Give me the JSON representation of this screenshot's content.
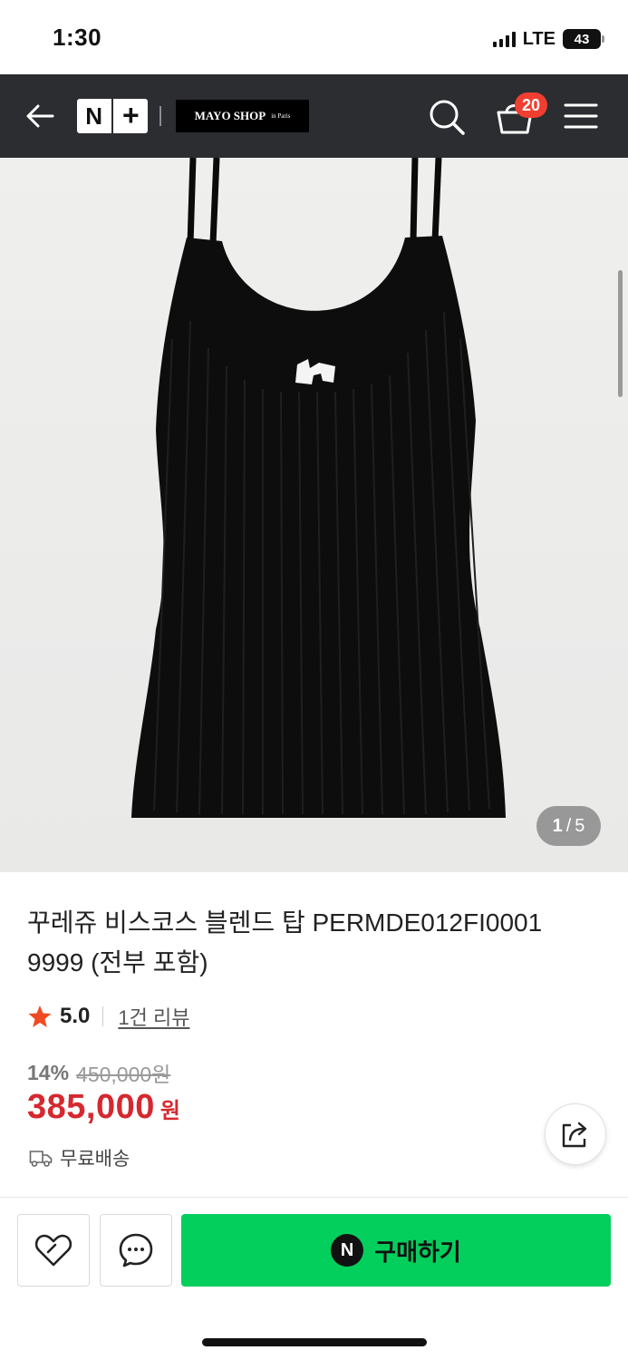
{
  "status_bar": {
    "time": "1:30",
    "network": "LTE",
    "battery": "43"
  },
  "header": {
    "logo_n": "N",
    "logo_plus": "+",
    "shop_name": "MAYO SHOP",
    "shop_sub": "in Paris",
    "cart_count": "20",
    "background_color": "#2b2d30"
  },
  "gallery": {
    "current": "1",
    "separator": "/",
    "total": "5"
  },
  "product": {
    "title": "꾸레쥬 비스코스 블렌드 탑 PERMDE012FI0001 9999 (전부 포함)",
    "rating": "5.0",
    "review_link": "1건 리뷰",
    "discount": "14%",
    "original_price": "450,000원",
    "price": "385,000",
    "currency": "원",
    "shipping": "무료배송",
    "price_color": "#d6282f"
  },
  "bottom_bar": {
    "naver_badge": "N",
    "buy_label": "구매하기",
    "buy_color": "#03cf5d"
  },
  "icons": [
    "back-arrow-icon",
    "search-icon",
    "cart-icon",
    "menu-icon",
    "star-icon",
    "truck-icon",
    "share-icon",
    "heart-icon",
    "chat-icon"
  ]
}
